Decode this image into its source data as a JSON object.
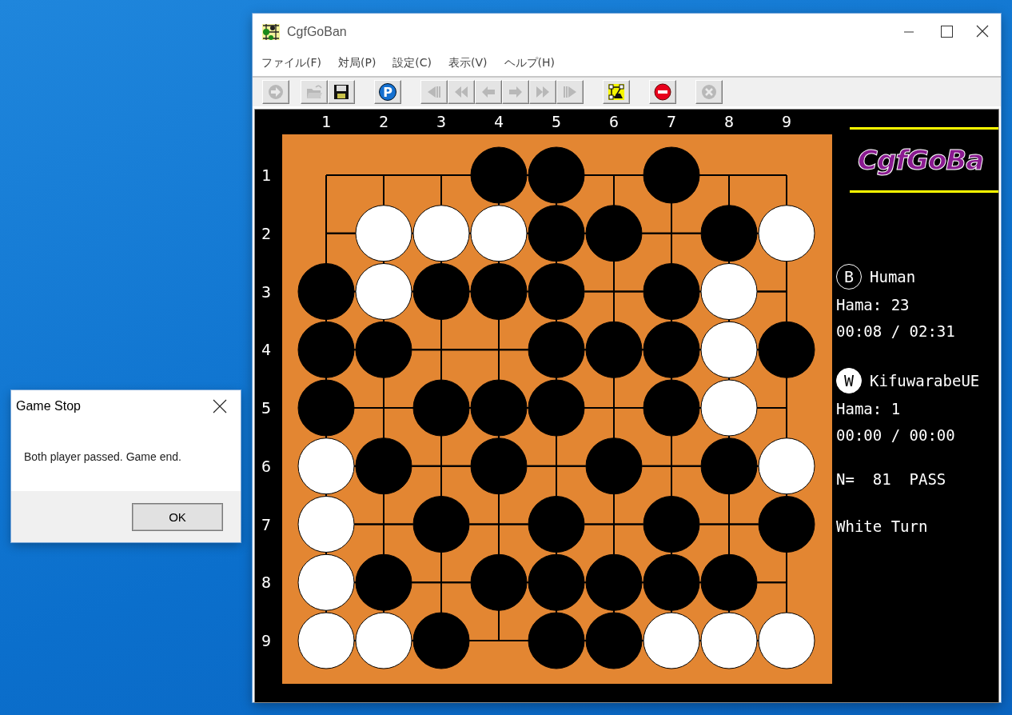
{
  "window": {
    "title": "CgfGoBan"
  },
  "menu": [
    {
      "label": "ファイル(F)"
    },
    {
      "label": "対局(P)"
    },
    {
      "label": "設定(C)"
    },
    {
      "label": "表示(V)"
    },
    {
      "label": "ヘルプ(H)"
    }
  ],
  "toolbar": [
    [
      {
        "kind": "go",
        "disabled": true
      }
    ],
    [
      {
        "kind": "open",
        "disabled": true
      },
      {
        "kind": "save",
        "disabled": false
      }
    ],
    [
      {
        "kind": "pass",
        "disabled": false,
        "label": "P"
      }
    ],
    [
      {
        "kind": "first",
        "disabled": true
      },
      {
        "kind": "back-fast",
        "disabled": true
      },
      {
        "kind": "back",
        "disabled": true
      },
      {
        "kind": "forward",
        "disabled": true
      },
      {
        "kind": "forward-fast",
        "disabled": true
      },
      {
        "kind": "last",
        "disabled": true
      }
    ],
    [
      {
        "kind": "board-edit",
        "disabled": false
      }
    ],
    [
      {
        "kind": "stop",
        "disabled": false
      }
    ],
    [
      {
        "kind": "close",
        "disabled": true
      }
    ]
  ],
  "board": {
    "column_labels": [
      "1",
      "2",
      "3",
      "4",
      "5",
      "6",
      "7",
      "8",
      "9"
    ],
    "row_labels": [
      "1",
      "2",
      "3",
      "4",
      "5",
      "6",
      "7",
      "8",
      "9"
    ],
    "stones": [
      [
        {
          "occupied": false
        },
        {
          "occupied": false
        },
        {
          "occupied": false
        },
        {
          "occupied": true,
          "color": "#000000"
        },
        {
          "occupied": true,
          "color": "#000000"
        },
        {
          "occupied": false
        },
        {
          "occupied": true,
          "color": "#000000"
        },
        {
          "occupied": false
        },
        {
          "occupied": false
        }
      ],
      [
        {
          "occupied": false
        },
        {
          "occupied": true,
          "color": "#ffffff"
        },
        {
          "occupied": true,
          "color": "#ffffff"
        },
        {
          "occupied": true,
          "color": "#ffffff"
        },
        {
          "occupied": true,
          "color": "#000000"
        },
        {
          "occupied": true,
          "color": "#000000"
        },
        {
          "occupied": false
        },
        {
          "occupied": true,
          "color": "#000000"
        },
        {
          "occupied": true,
          "color": "#ffffff"
        }
      ],
      [
        {
          "occupied": true,
          "color": "#000000"
        },
        {
          "occupied": true,
          "color": "#ffffff"
        },
        {
          "occupied": true,
          "color": "#000000"
        },
        {
          "occupied": true,
          "color": "#000000"
        },
        {
          "occupied": true,
          "color": "#000000"
        },
        {
          "occupied": false
        },
        {
          "occupied": true,
          "color": "#000000"
        },
        {
          "occupied": true,
          "color": "#ffffff"
        },
        {
          "occupied": false
        }
      ],
      [
        {
          "occupied": true,
          "color": "#000000"
        },
        {
          "occupied": true,
          "color": "#000000"
        },
        {
          "occupied": false
        },
        {
          "occupied": false
        },
        {
          "occupied": true,
          "color": "#000000"
        },
        {
          "occupied": true,
          "color": "#000000"
        },
        {
          "occupied": true,
          "color": "#000000"
        },
        {
          "occupied": true,
          "color": "#ffffff"
        },
        {
          "occupied": true,
          "color": "#000000"
        }
      ],
      [
        {
          "occupied": true,
          "color": "#000000"
        },
        {
          "occupied": false
        },
        {
          "occupied": true,
          "color": "#000000"
        },
        {
          "occupied": true,
          "color": "#000000"
        },
        {
          "occupied": true,
          "color": "#000000"
        },
        {
          "occupied": false
        },
        {
          "occupied": true,
          "color": "#000000"
        },
        {
          "occupied": true,
          "color": "#ffffff"
        },
        {
          "occupied": false
        }
      ],
      [
        {
          "occupied": true,
          "color": "#ffffff"
        },
        {
          "occupied": true,
          "color": "#000000"
        },
        {
          "occupied": false
        },
        {
          "occupied": true,
          "color": "#000000"
        },
        {
          "occupied": false
        },
        {
          "occupied": true,
          "color": "#000000"
        },
        {
          "occupied": false
        },
        {
          "occupied": true,
          "color": "#000000"
        },
        {
          "occupied": true,
          "color": "#ffffff"
        }
      ],
      [
        {
          "occupied": true,
          "color": "#ffffff"
        },
        {
          "occupied": false
        },
        {
          "occupied": true,
          "color": "#000000"
        },
        {
          "occupied": false
        },
        {
          "occupied": true,
          "color": "#000000"
        },
        {
          "occupied": false
        },
        {
          "occupied": true,
          "color": "#000000"
        },
        {
          "occupied": false
        },
        {
          "occupied": true,
          "color": "#000000"
        }
      ],
      [
        {
          "occupied": true,
          "color": "#ffffff"
        },
        {
          "occupied": true,
          "color": "#000000"
        },
        {
          "occupied": false
        },
        {
          "occupied": true,
          "color": "#000000"
        },
        {
          "occupied": true,
          "color": "#000000"
        },
        {
          "occupied": true,
          "color": "#000000"
        },
        {
          "occupied": true,
          "color": "#000000"
        },
        {
          "occupied": true,
          "color": "#000000"
        },
        {
          "occupied": false
        }
      ],
      [
        {
          "occupied": true,
          "color": "#ffffff"
        },
        {
          "occupied": true,
          "color": "#ffffff"
        },
        {
          "occupied": true,
          "color": "#000000"
        },
        {
          "occupied": false
        },
        {
          "occupied": true,
          "color": "#000000"
        },
        {
          "occupied": true,
          "color": "#000000"
        },
        {
          "occupied": true,
          "color": "#ffffff"
        },
        {
          "occupied": true,
          "color": "#ffffff"
        },
        {
          "occupied": true,
          "color": "#ffffff"
        }
      ]
    ]
  },
  "info": {
    "logo": "CgfGoBa",
    "players": [
      {
        "color": "#000000",
        "mark": "B",
        "name": "Human",
        "hama": "Hama: 23",
        "time": "00:08 / 02:31"
      },
      {
        "color": "#ffffff",
        "mark": "W",
        "name": "KifuwarabeUE",
        "hama": "Hama: 1",
        "time": "00:00 / 00:00"
      }
    ],
    "move": "N=  81  PASS",
    "turn": "White Turn"
  },
  "dialog": {
    "title": "Game Stop",
    "message": "Both player passed. Game end.",
    "button": "OK"
  }
}
